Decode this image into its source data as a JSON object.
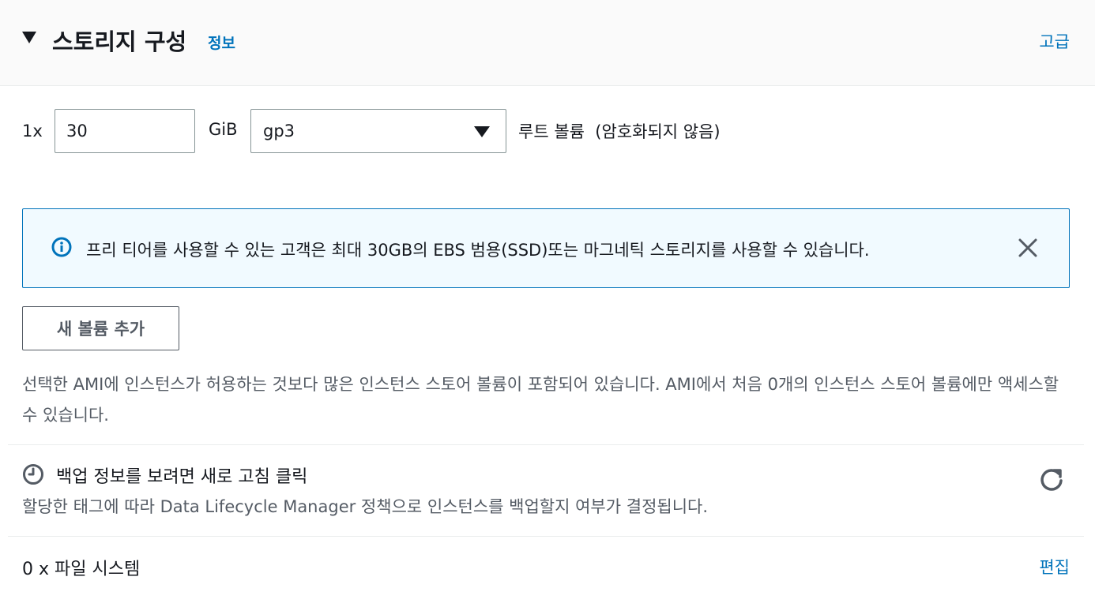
{
  "header": {
    "title": "스토리지 구성",
    "info_link": "정보",
    "advanced_link": "고급"
  },
  "volume": {
    "count": "1x",
    "size_value": "30",
    "unit": "GiB",
    "type_selected": "gp3",
    "root_label": "루트 볼륨  (암호화되지 않음)"
  },
  "alert": {
    "message": "프리 티어를 사용할 수 있는 고객은 최대 30GB의 EBS 범용(SSD)또는 마그네틱 스토리지를 사용할 수 있습니다."
  },
  "add_volume_button": "새 볼륨 추가",
  "instance_store_note": "선택한 AMI에 인스턴스가 허용하는 것보다 많은 인스턴스 스토어 볼륨이 포함되어 있습니다. AMI에서 처음 0개의 인스턴스 스토어 볼륨에만 액세스할 수 있습니다.",
  "backup": {
    "title": "백업 정보를 보려면 새로 고침 클릭",
    "description": "할당한 태그에 따라 Data Lifecycle Manager 정책으로 인스턴스를 백업할지 여부가 결정됩니다."
  },
  "filesystem": {
    "label": "0 x 파일 시스템",
    "edit_link": "편집"
  },
  "colors": {
    "link": "#0073bb",
    "alert_bg": "#f1faff",
    "alert_border": "#0073bb",
    "text_secondary": "#545b64"
  }
}
